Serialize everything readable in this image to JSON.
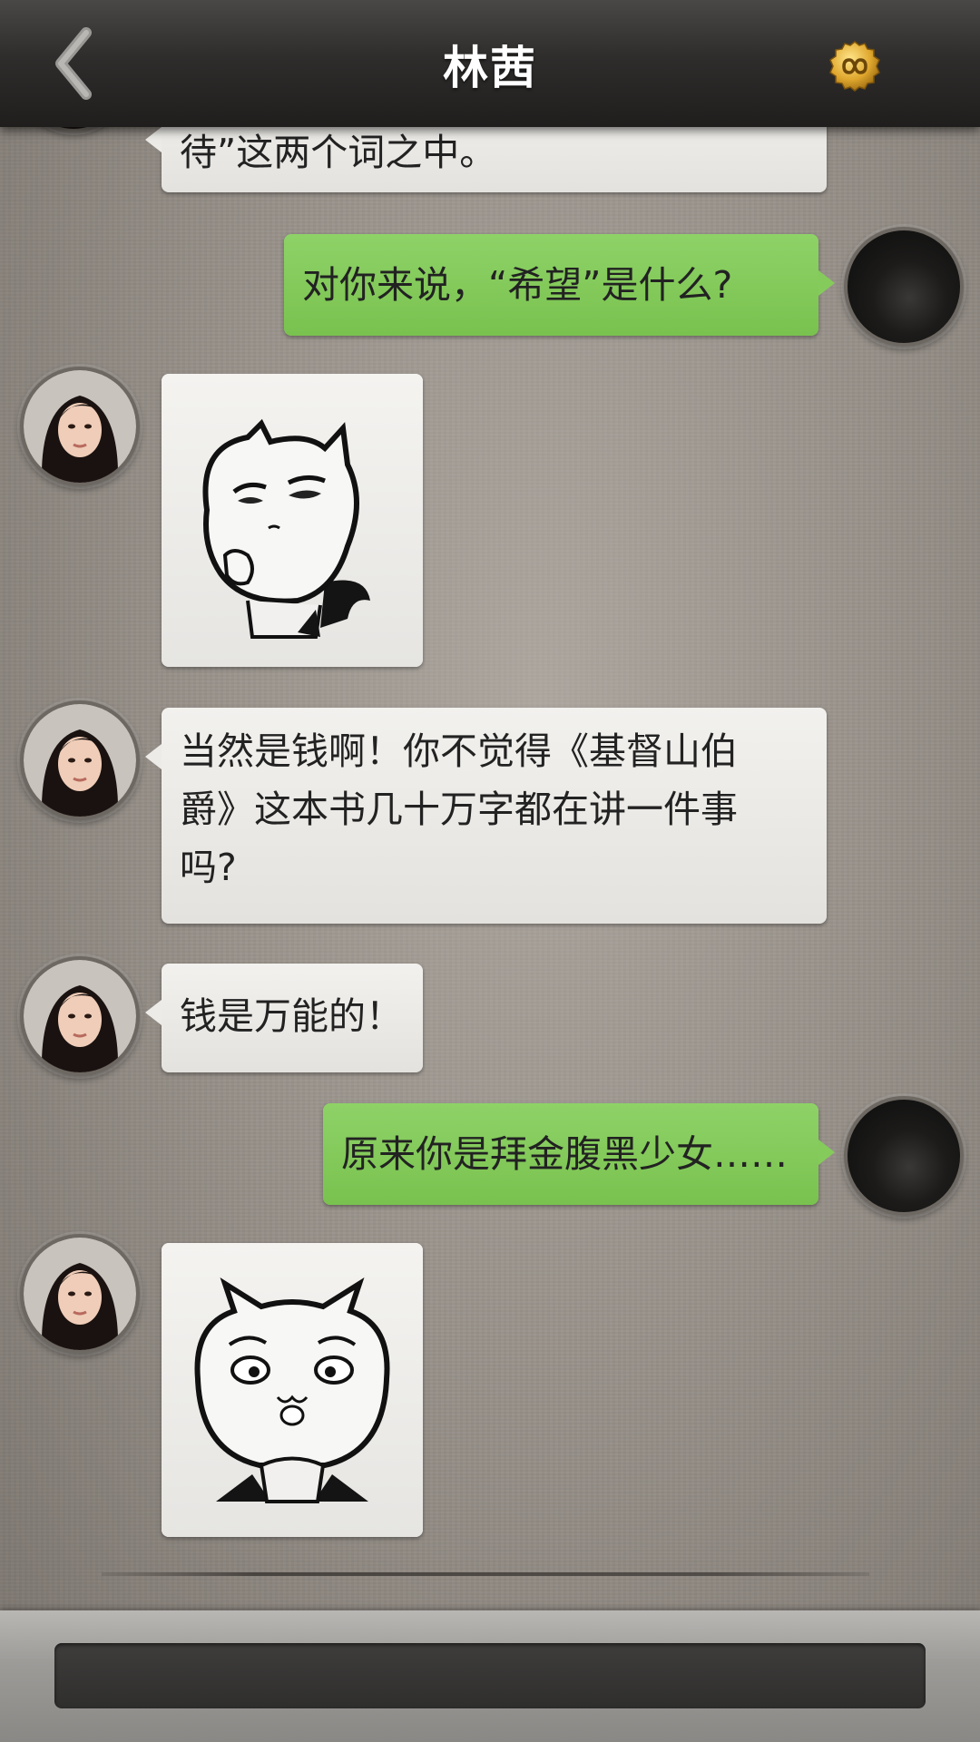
{
  "header": {
    "title": "林茜",
    "back_icon": "chevron-left-icon",
    "right_icon": "infinity-coin-icon"
  },
  "messages": [
    {
      "side": "left",
      "type": "text",
      "text": "待”这两个词之中。",
      "partial": true
    },
    {
      "side": "right",
      "type": "text",
      "text": "对你来说，“希望”是什么?"
    },
    {
      "side": "left",
      "type": "sticker",
      "sticker": "thinking-cat-sticker"
    },
    {
      "side": "left",
      "type": "text",
      "lines": [
        "当然是钱啊！你不觉得《基督山伯",
        "爵》这本书几十万字都在讲一件事",
        "吗?"
      ]
    },
    {
      "side": "left",
      "type": "text",
      "text": "钱是万能的！"
    },
    {
      "side": "right",
      "type": "text",
      "text": "原来你是拜金腹黑少女……"
    },
    {
      "side": "left",
      "type": "sticker",
      "sticker": "worried-cat-sticker"
    }
  ],
  "colors": {
    "green_bubble": "#85cb5b",
    "white_bubble": "#ecebe8",
    "header": "#2f2d2c",
    "coin": "#e0a82e"
  },
  "input": {
    "value": "",
    "placeholder": ""
  }
}
